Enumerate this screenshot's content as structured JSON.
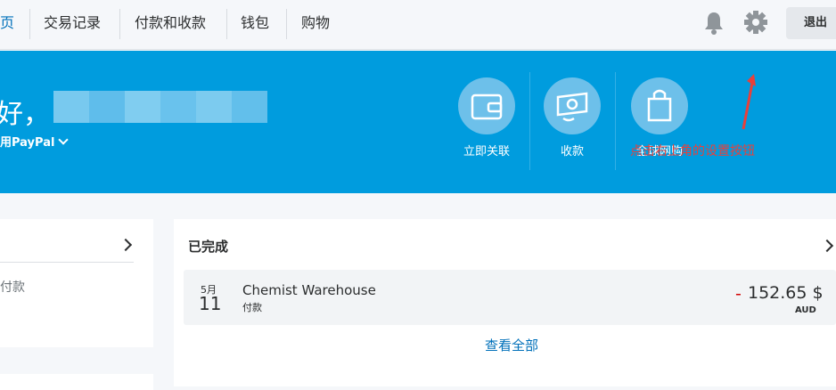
{
  "nav": {
    "active_item": "页",
    "items": [
      "交易记录",
      "付款和收款",
      "钱包",
      "购物"
    ],
    "logout": "退出"
  },
  "hero": {
    "greeting": "好，",
    "use_paypal": "用PayPal",
    "actions": [
      {
        "label": "立即关联",
        "icon": "wallet-icon"
      },
      {
        "label": "收款",
        "icon": "receive-money-icon"
      },
      {
        "label": "全球网购",
        "icon": "shopping-bag-icon"
      }
    ],
    "annotation": "点击右上角的设置按钮"
  },
  "left_card": {
    "text": "付款"
  },
  "completed": {
    "title": "已完成",
    "transaction": {
      "month": "5月",
      "day": "11",
      "merchant": "Chemist Warehouse",
      "type": "付款",
      "sign": "-",
      "amount": "152.65 $",
      "currency": "AUD"
    },
    "view_all": "查看全部"
  },
  "colors": {
    "brand_blue": "#009cde",
    "link_blue": "#0070ba",
    "annotation_red": "#e8403b",
    "negative_red": "#d20000"
  }
}
